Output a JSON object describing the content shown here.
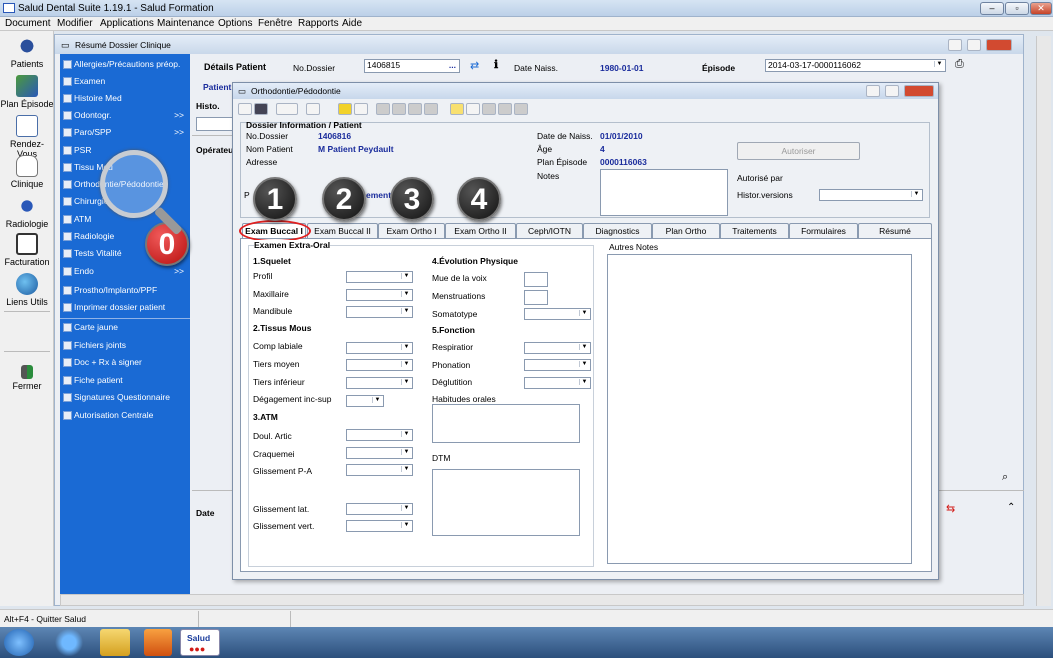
{
  "app": {
    "title": "Salud Dental Suite 1.19.1 - Salud Formation"
  },
  "menu": [
    "Document",
    "Modifier",
    "Applications",
    "Maintenance",
    "Options",
    "Fenêtre",
    "Rapports",
    "Aide"
  ],
  "leftbar": [
    "Patients",
    "Plan Épisode",
    "Rendez-Vous",
    "Clinique",
    "Radiologie",
    "Facturation",
    "Liens Utils",
    "Fermer"
  ],
  "inner": {
    "title": "Résumé Dossier Clinique",
    "details_label": "Détails Patient",
    "nodossier_label": "No.Dossier",
    "nodossier_value": "1406815",
    "dots": "...",
    "date_naiss_label": "Date Naiss.",
    "date_naiss_value": "1980-01-01",
    "episode_label": "Épisode",
    "episode_value": "2014-03-17-0000116062",
    "patient_tab": "Patient",
    "histo_label": "Histo.",
    "operateur_label": "Opérateur",
    "date_label": "Date"
  },
  "nav": [
    {
      "label": "Allergies/Précautions préop.",
      "arrow": ""
    },
    {
      "label": "Examen",
      "arrow": ""
    },
    {
      "label": "Histoire Med",
      "arrow": ""
    },
    {
      "label": "Odontogr.",
      "arrow": ">>"
    },
    {
      "label": "Paro/SPP",
      "arrow": ">>"
    },
    {
      "label": "PSR",
      "arrow": ""
    },
    {
      "label": "Tissu Mou",
      "arrow": ""
    },
    {
      "label": "Orthodontie/Pédodontie",
      "arrow": ""
    },
    {
      "label": "Chirurgie",
      "arrow": ""
    },
    {
      "label": "ATM",
      "arrow": ""
    },
    {
      "label": "Radiologie",
      "arrow": ""
    },
    {
      "label": "Tests Vitalité",
      "arrow": ""
    },
    {
      "label": "Endo",
      "arrow": ">>"
    },
    {
      "label": "Prostho/Implanto/PPF",
      "arrow": ""
    },
    {
      "label": "Imprimer dossier patient",
      "arrow": ""
    },
    {
      "label": "Carte jaune",
      "arrow": ""
    },
    {
      "label": "Fichiers joints",
      "arrow": ""
    },
    {
      "label": "Doc + Rx à signer",
      "arrow": ""
    },
    {
      "label": "Fiche patient",
      "arrow": ""
    },
    {
      "label": "Signatures Questionnaire",
      "arrow": ""
    },
    {
      "label": "Autorisation Centrale",
      "arrow": ""
    }
  ],
  "dialog": {
    "title": "Orthodontie/Pédodontie",
    "section": "Dossier Information / Patient",
    "nodossier_label": "No.Dossier",
    "nodossier_value": "1406816",
    "nom_label": "Nom Patient",
    "nom_value": "M Patient Peydault",
    "adresse_label": "Adresse",
    "dob_label": "Date de Naiss.",
    "dob_value": "01/01/2010",
    "age_label": "Âge",
    "age_value": "4",
    "plan_label": "Plan Épisode",
    "plan_value": "0000116063",
    "notes_label": "Notes",
    "autoriser": "Autoriser",
    "autorise_par": "Autorisé par",
    "histor": "Histor.versions",
    "partial_p": "P",
    "partial_ement": "ement"
  },
  "tabs": [
    "Exam Buccal I",
    "Exam Buccal II",
    "Exam Ortho I",
    "Exam Ortho II",
    "Ceph/IOTN",
    "Diagnostics",
    "Plan Ortho",
    "Traitements",
    "Formulaires",
    "Résumé Formulaires"
  ],
  "form": {
    "examen_title": "Examen Extra-Oral",
    "squelet": "1.Squelet",
    "profil": "Profil",
    "maxillaire": "Maxillaire",
    "mandibule": "Mandibule",
    "tissus": "2.Tissus Mous",
    "comp_labiale": "Comp labiale",
    "tiers_moyen": "Tiers moyen",
    "tiers_inf": "Tiers inférieur",
    "degagement": "Dégagement inc-sup",
    "atm": "3.ATM",
    "doul": "Doul. Artic",
    "craque": "Craquemei",
    "gliss_pa": "Glissement P-A",
    "gliss_lat": "Glissement lat.",
    "gliss_vert": "Glissement vert.",
    "evolution": "4.Évolution Physique",
    "mue": "Mue de la voix",
    "menstru": "Menstruations",
    "somato": "Somatotype",
    "fonction": "5.Fonction",
    "respiration": "Respiratior",
    "phonation": "Phonation",
    "deglutition": "Déglutition",
    "habitudes": "Habitudes orales",
    "dtm": "DTM",
    "autres_notes": "Autres Notes"
  },
  "callouts": [
    "1",
    "2",
    "3",
    "4",
    "0"
  ],
  "status": {
    "text": "Alt+F4 - Quitter Salud"
  },
  "taskbar": {
    "salud": "Salud"
  },
  "colors": {
    "nav_bg": "#1a6ad4",
    "callout_red": "#d21a16",
    "highlight_ring": "#e02020"
  }
}
